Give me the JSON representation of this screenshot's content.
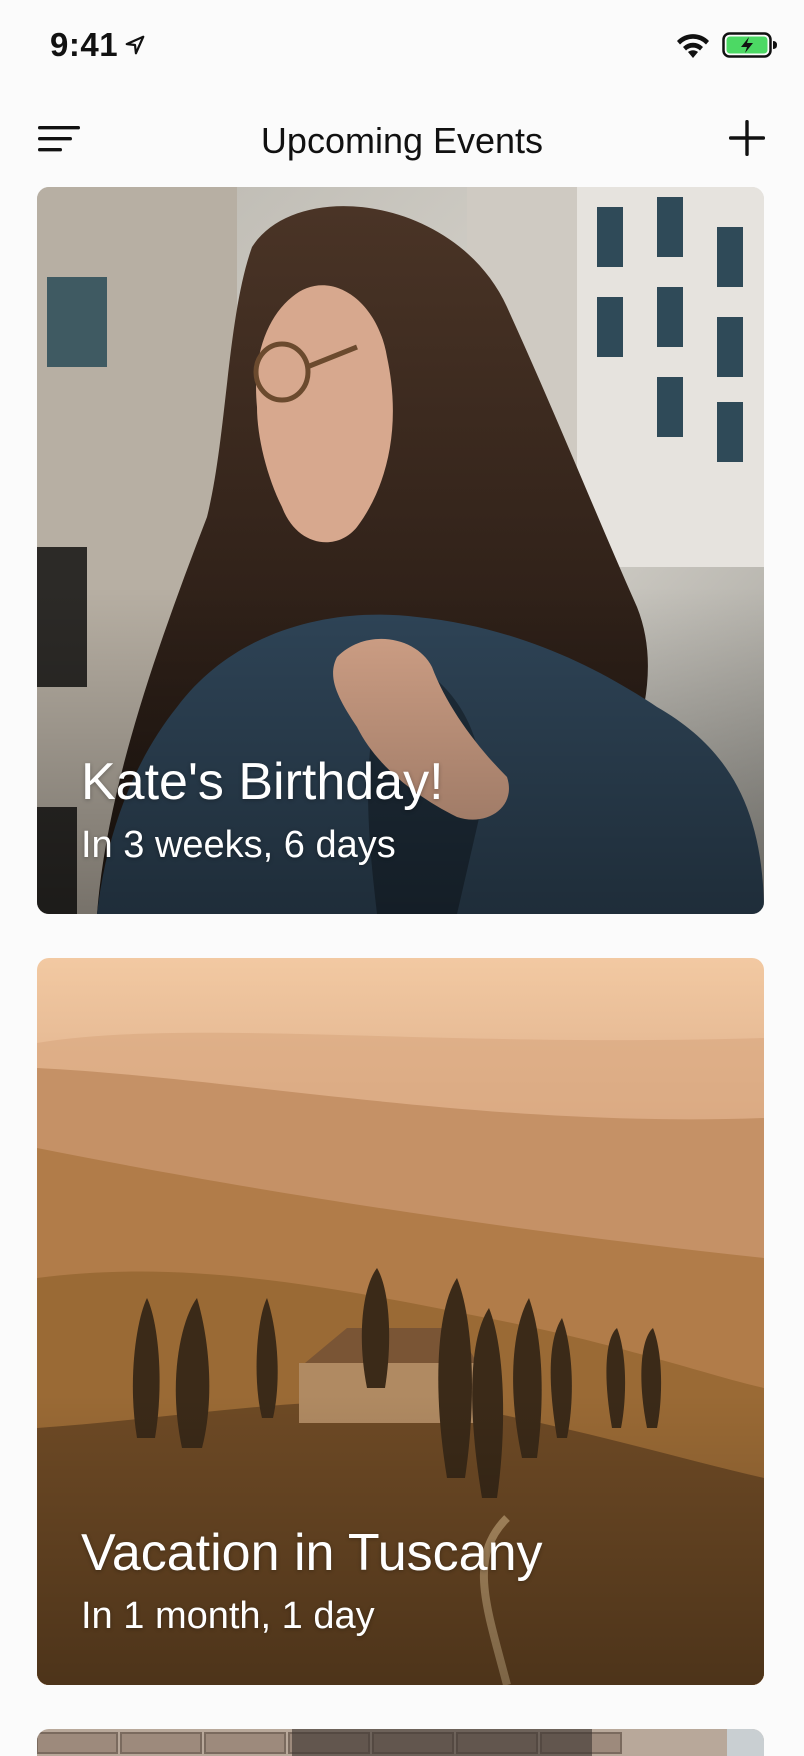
{
  "status_bar": {
    "time": "9:41",
    "icons": [
      "location-arrow-icon",
      "wifi-icon",
      "battery-charging-icon"
    ],
    "battery_color": "#4cd964"
  },
  "nav": {
    "title": "Upcoming Events",
    "left_icon": "menu-icon",
    "right_icon": "add-icon"
  },
  "events": [
    {
      "title": "Kate's Birthday!",
      "countdown": "In 3 weeks, 6 days",
      "image": "woman-with-long-hair-photo"
    },
    {
      "title": "Vacation in Tuscany",
      "countdown": "In 1 month, 1 day",
      "image": "tuscany-hills-landscape-photo"
    },
    {
      "title": "",
      "countdown": "",
      "image": "brick-wall-photo"
    }
  ]
}
